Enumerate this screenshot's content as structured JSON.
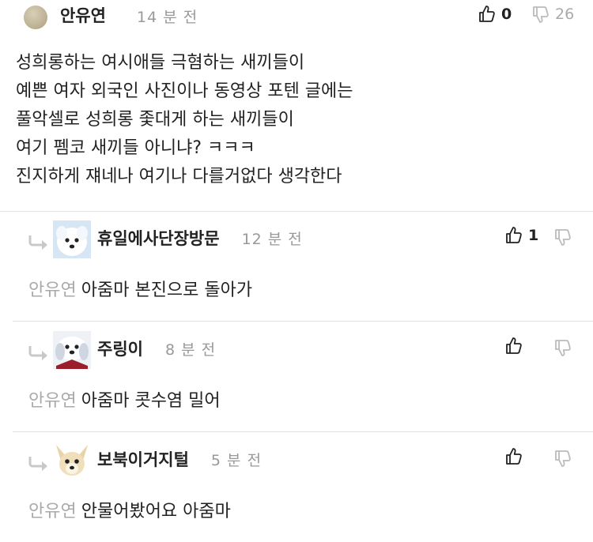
{
  "comment": {
    "author": "안유연",
    "time": "14 분 전",
    "likes": "0",
    "dislikes": "26",
    "lines": [
      "성희롱하는 여시애들 극혐하는 새끼들이",
      "예쁜 여자 외국인 사진이나 동영상 포텐 글에는",
      "풀악셀로 성희롱 좇대게 하는 새끼들이",
      "여기 펨코 새끼들 아니냐? ㅋㅋㅋ",
      "진지하게 쟤네나 여기나 다를거없다 생각한다"
    ]
  },
  "replies": [
    {
      "author": "휴일에사단장방문",
      "time": "12 분 전",
      "likes": "1",
      "mention": "안유연",
      "text": "아줌마 본진으로 돌아가"
    },
    {
      "author": "주링이",
      "time": "8 분 전",
      "likes": "",
      "mention": "안유연",
      "text": "아줌마 콧수염 밀어"
    },
    {
      "author": "보북이거지털",
      "time": "5 분 전",
      "likes": "",
      "mention": "안유연",
      "text": "안물어봤어요 아줌마"
    }
  ]
}
